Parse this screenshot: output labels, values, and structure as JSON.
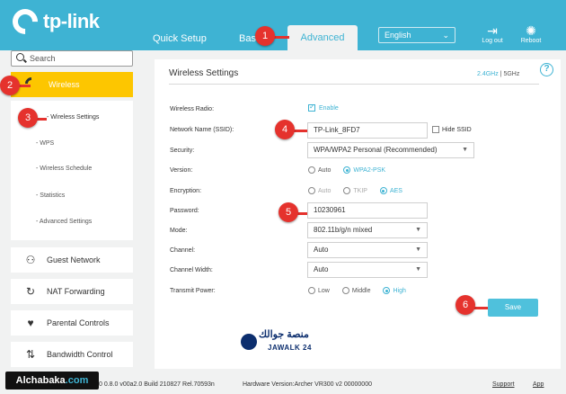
{
  "header": {
    "brand": "tp-link",
    "tabs": {
      "quick_setup": "Quick Setup",
      "basic": "Bas",
      "advanced": "Advanced"
    },
    "language": "English",
    "logout": "Log out",
    "reboot": "Reboot"
  },
  "sidebar": {
    "search_placeholder": "Search",
    "wireless": "Wireless",
    "sub_items": [
      "- Wireless Settings",
      "- WPS",
      "- Wireless Schedule",
      "- Statistics",
      "- Advanced Settings"
    ],
    "items": [
      "Guest Network",
      "NAT Forwarding",
      "Parental Controls",
      "Bandwidth Control"
    ]
  },
  "main": {
    "title": "Wireless Settings",
    "band_24": "2.4GHz",
    "band_sep": "|",
    "band_5": "5GHz",
    "help": "?",
    "labels": {
      "radio": "Wireless Radio:",
      "ssid": "Network Name (SSID):",
      "security": "Security:",
      "version": "Version:",
      "encryption": "Encryption:",
      "password": "Password:",
      "mode": "Mode:",
      "channel": "Channel:",
      "channel_width": "Channel Width:",
      "transmit_power": "Transmit Power:"
    },
    "enable": "Enable",
    "ssid_value": "TP-Link_8FD7",
    "hide_ssid": "Hide SSID",
    "security_value": "WPA/WPA2 Personal (Recommended)",
    "version_auto": "Auto",
    "version_wpa2": "WPA2-PSK",
    "enc_auto": "Auto",
    "enc_tkip": "TKIP",
    "enc_aes": "AES",
    "password_value": "10230961",
    "mode_value": "802.11b/g/n mixed",
    "channel_value": "Auto",
    "channel_width_value": "Auto",
    "tx_low": "Low",
    "tx_middle": "Middle",
    "tx_high": "High",
    "save": "Save"
  },
  "steps": [
    "1",
    "2",
    "3",
    "4",
    "5",
    "6"
  ],
  "footer": {
    "firmware": "0 0.8.0 v00a2.0 Build 210827 Rel.70593n",
    "hardware": "Hardware Version:Archer VR300 v2 00000000",
    "support": "Support",
    "app": "App"
  },
  "watermarks": {
    "alchabaka": "Alchabaka",
    "com": ".com",
    "jawalk_ar": "منصة جوالك",
    "jawalk_en": "JAWALK 24"
  },
  "colors": {
    "accent": "#3eb3d3",
    "highlight": "#fdc600",
    "step": "#e5322d"
  }
}
